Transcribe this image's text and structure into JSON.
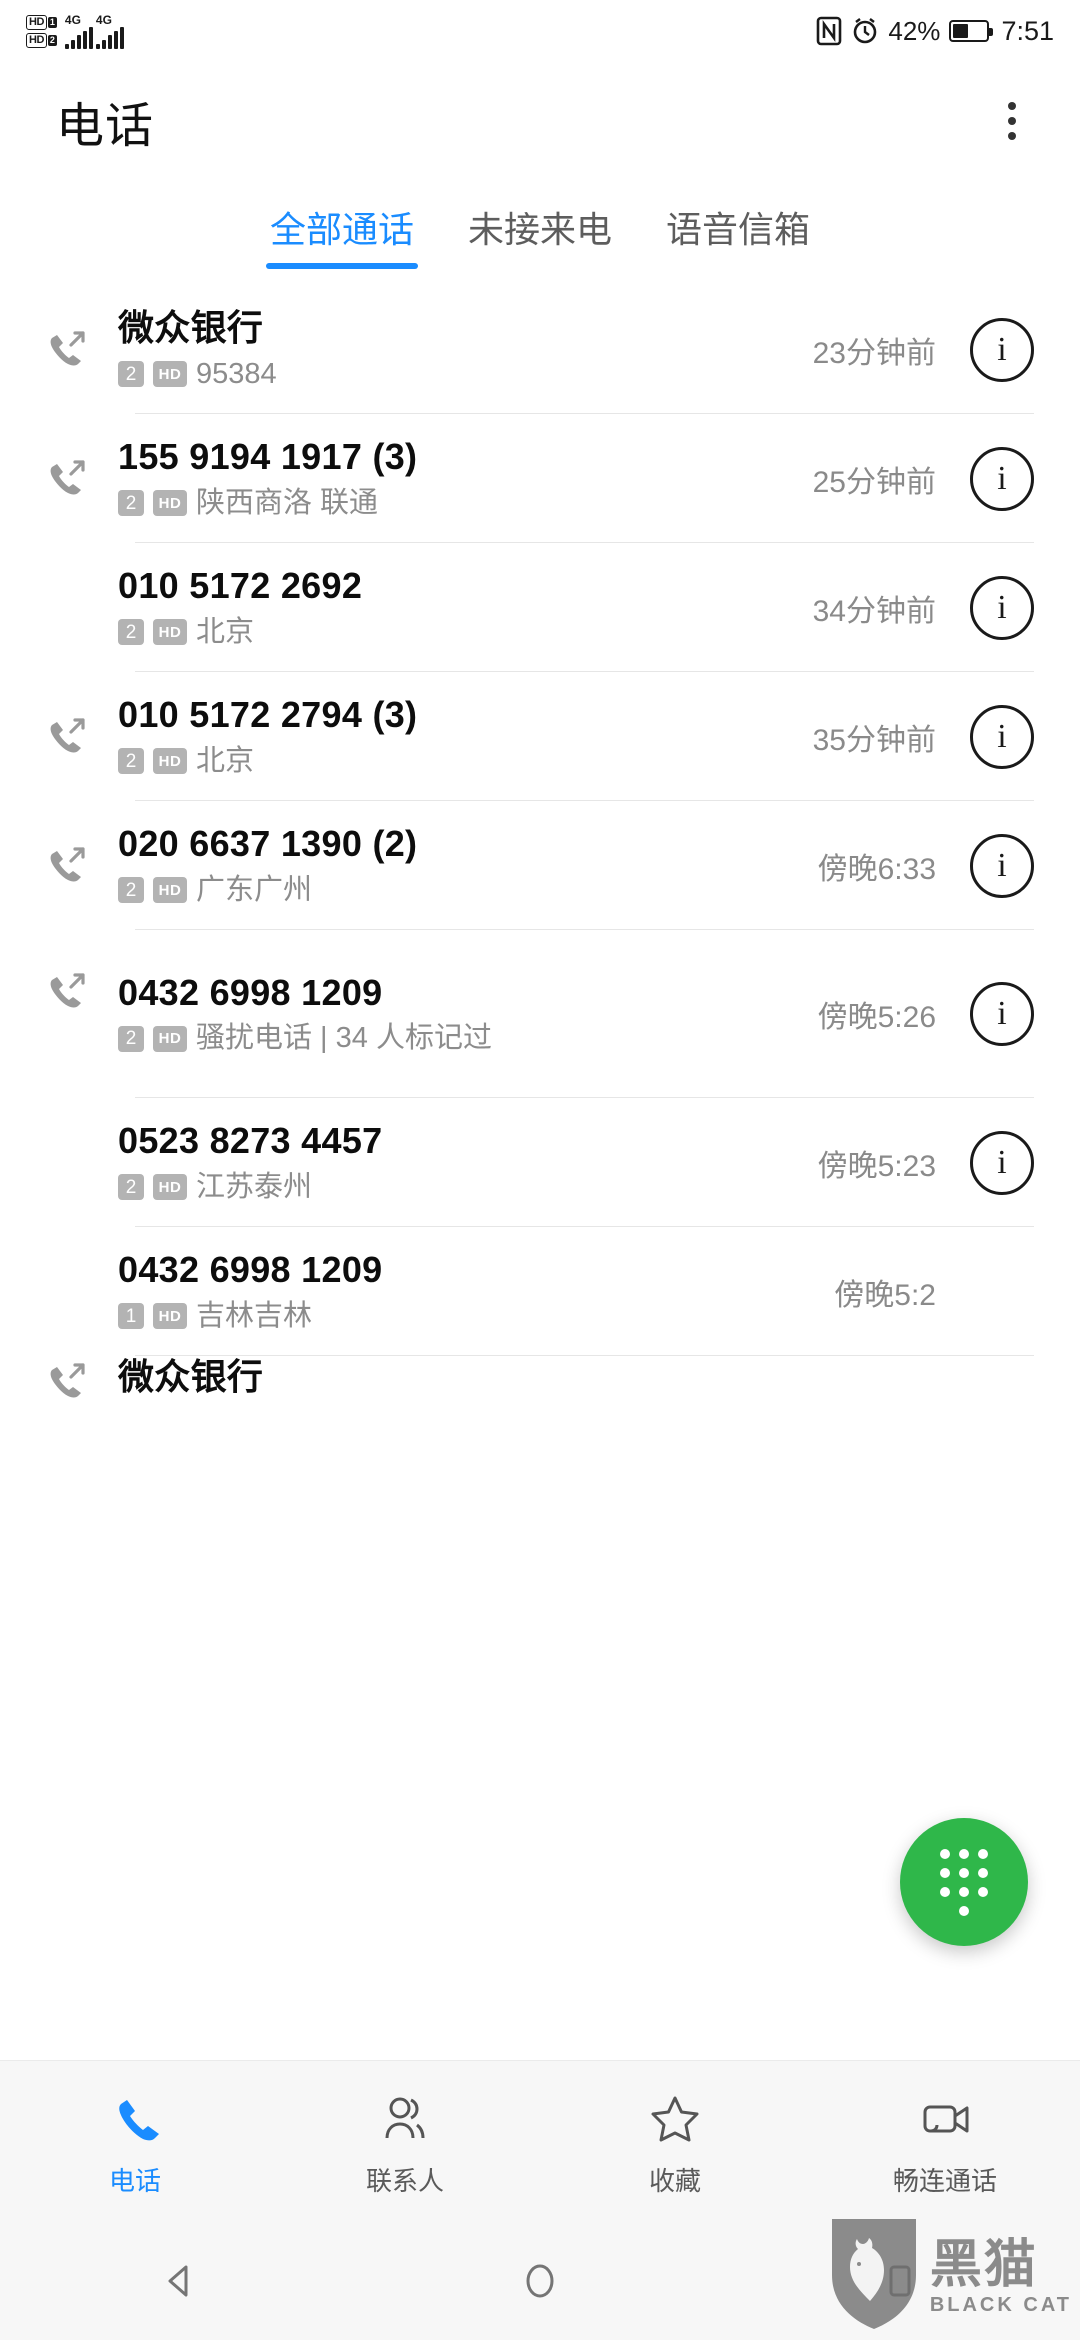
{
  "status_bar": {
    "hd1_label": "HD",
    "hd1_sim": "1",
    "hd2_label": "HD",
    "hd2_sim": "2",
    "network1": "4G",
    "network2": "4G",
    "nfc_icon": "nfc-icon",
    "alarm_icon": "alarm-clock-icon",
    "battery_percent": "42%",
    "battery_icon": "battery-charging-icon",
    "time": "7:51"
  },
  "header": {
    "title": "电话",
    "overflow_icon": "more-vertical-icon"
  },
  "tabs": [
    {
      "label": "全部通话",
      "active": true
    },
    {
      "label": "未接来电",
      "active": false
    },
    {
      "label": "语音信箱",
      "active": false
    }
  ],
  "calls": [
    {
      "title": "微众银行",
      "sim": "2",
      "hd": "HD",
      "subtitle": "95384",
      "time": "23分钟前",
      "direction": "outgoing",
      "info_icon": "info-circle-icon"
    },
    {
      "title": "155 9194 1917 (3)",
      "sim": "2",
      "hd": "HD",
      "subtitle": "陕西商洛 联通",
      "time": "25分钟前",
      "direction": "outgoing",
      "info_icon": "info-circle-icon"
    },
    {
      "title": "010 5172 2692",
      "sim": "2",
      "hd": "HD",
      "subtitle": "北京",
      "time": "34分钟前",
      "direction": "none",
      "info_icon": "info-circle-icon"
    },
    {
      "title": "010 5172 2794 (3)",
      "sim": "2",
      "hd": "HD",
      "subtitle": "北京",
      "time": "35分钟前",
      "direction": "outgoing",
      "info_icon": "info-circle-icon"
    },
    {
      "title": "020 6637 1390 (2)",
      "sim": "2",
      "hd": "HD",
      "subtitle": "广东广州",
      "time": "傍晚6:33",
      "direction": "outgoing",
      "info_icon": "info-circle-icon"
    },
    {
      "title": "0432 6998 1209",
      "sim": "2",
      "hd": "HD",
      "subtitle": "骚扰电话 | 34 人标记过",
      "time": "傍晚5:26",
      "direction": "outgoing",
      "info_icon": "info-circle-icon"
    },
    {
      "title": "0523 8273 4457",
      "sim": "2",
      "hd": "HD",
      "subtitle": "江苏泰州",
      "time": "傍晚5:23",
      "direction": "none",
      "info_icon": "info-circle-icon"
    },
    {
      "title": "0432 6998 1209",
      "sim": "1",
      "hd": "HD",
      "subtitle": "吉林吉林",
      "time": "傍晚5:2",
      "direction": "none",
      "info_icon": "info-circle-icon"
    },
    {
      "title": "微众银行",
      "sim": "",
      "hd": "",
      "subtitle": "",
      "time": "",
      "direction": "outgoing",
      "info_icon": "info-circle-icon"
    }
  ],
  "fab": {
    "icon": "dialpad-icon",
    "color": "#2fb74a"
  },
  "bottom_nav": [
    {
      "label": "电话",
      "icon": "phone-icon",
      "active": true
    },
    {
      "label": "联系人",
      "icon": "contacts-icon",
      "active": false
    },
    {
      "label": "收藏",
      "icon": "star-icon",
      "active": false
    },
    {
      "label": "畅连通话",
      "icon": "video-call-icon",
      "active": false
    }
  ],
  "system_nav": [
    {
      "name": "back-button",
      "icon": "triangle-left-icon"
    },
    {
      "name": "home-button",
      "icon": "circle-icon"
    },
    {
      "name": "recents-button",
      "icon": "square-icon"
    }
  ],
  "watermark": {
    "cn": "黑猫",
    "en": "BLACK CAT",
    "icon": "black-cat-shield-logo"
  },
  "theme": {
    "accent": "#1a8cff",
    "fab_green": "#2fb74a",
    "text_primary": "#0d0d0d",
    "text_secondary": "#8c8c8c"
  }
}
